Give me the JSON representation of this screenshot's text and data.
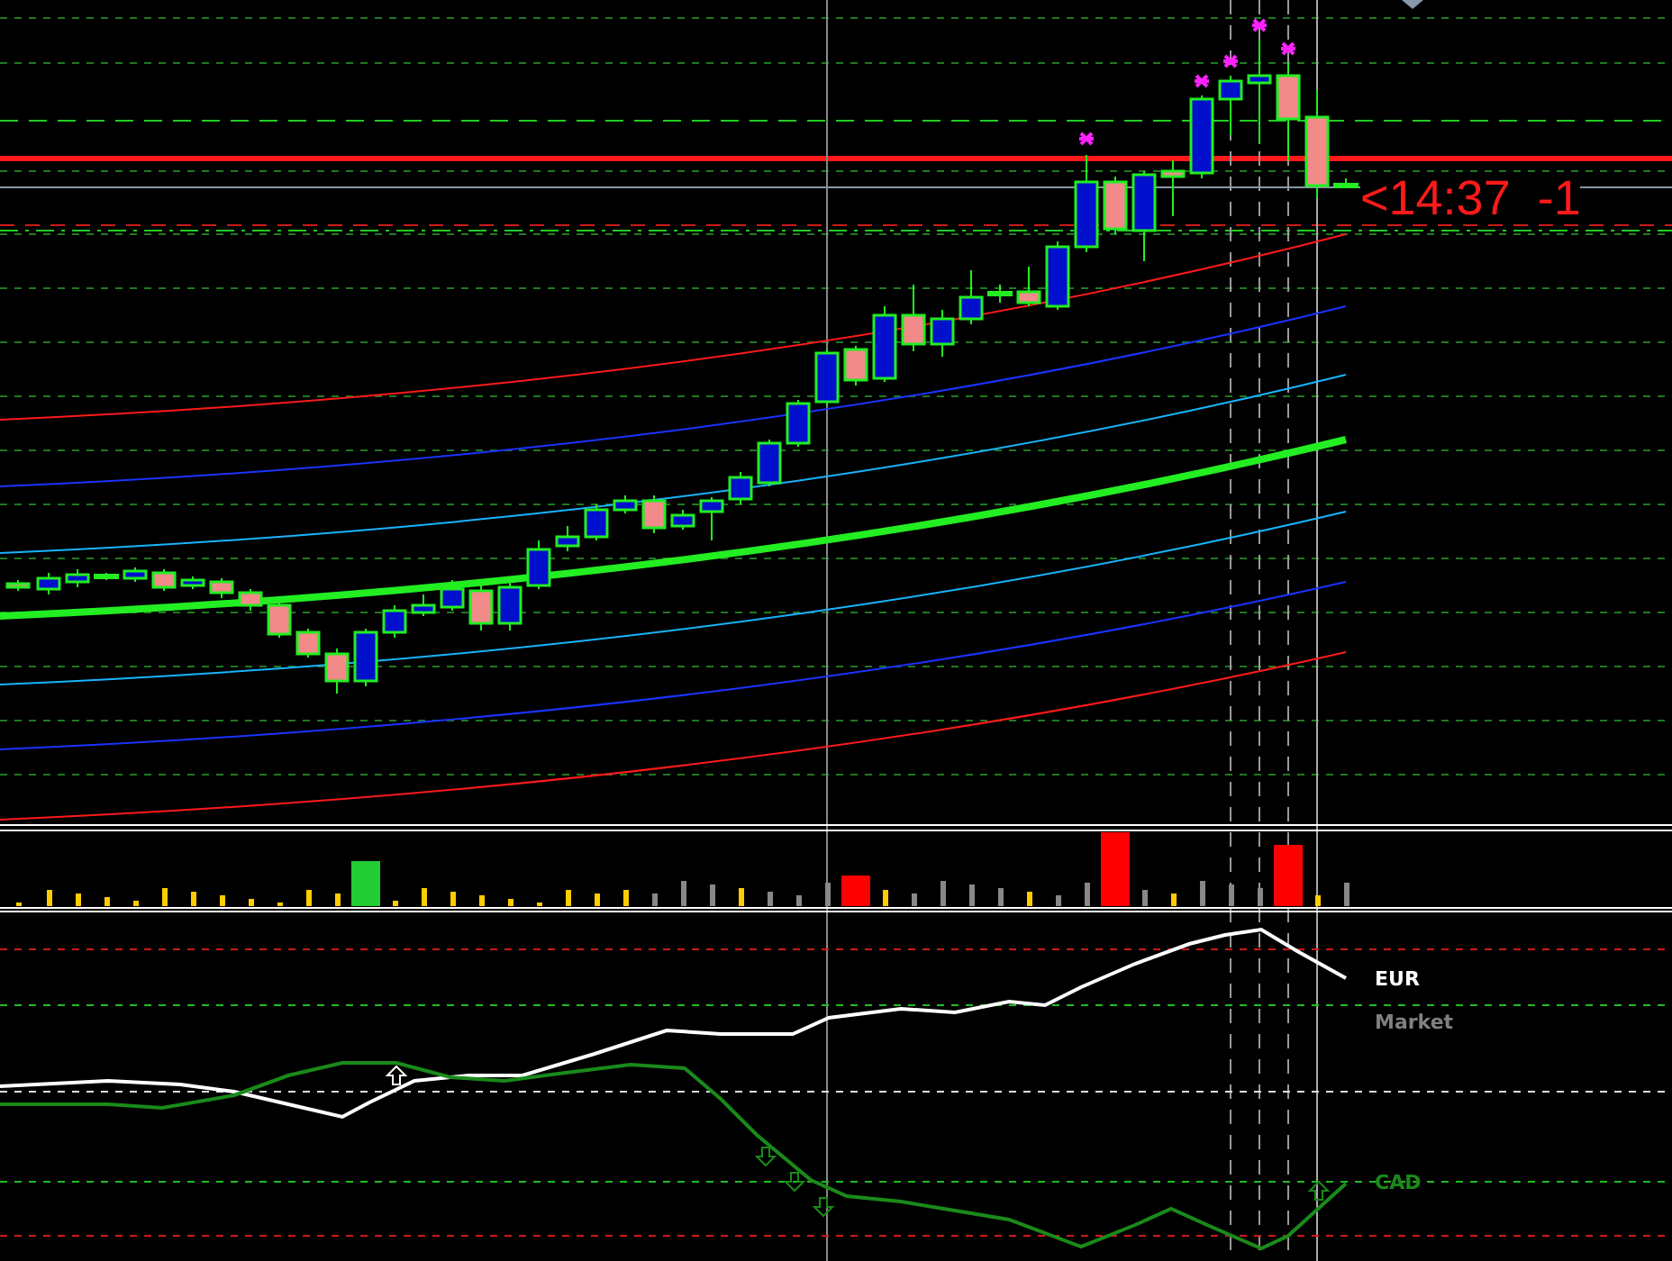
{
  "price_chart": {
    "countdown_label": "<14:37  -1"
  },
  "strength_panel": {
    "legend": [
      {
        "text": "EUR",
        "color": "#ffffff"
      },
      {
        "text": "Market",
        "color": "#808080"
      },
      {
        "text": "CAD",
        "color": "#1a8a1a"
      }
    ]
  }
}
